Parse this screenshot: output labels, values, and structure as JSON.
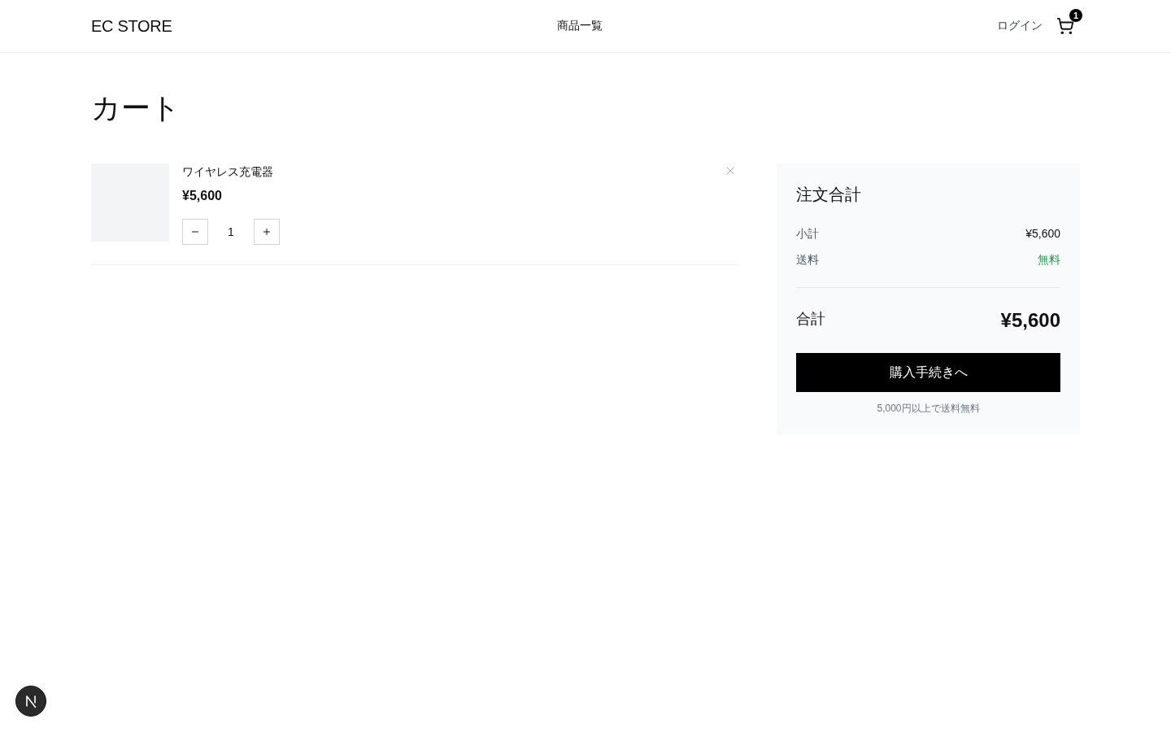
{
  "header": {
    "logo": "EC STORE",
    "nav": [
      {
        "label": "商品一覧"
      }
    ],
    "login": "ログイン",
    "cart_count": "1"
  },
  "page_title": "カート",
  "cart_items": [
    {
      "name": "ワイヤレス充電器",
      "price": "¥5,600",
      "quantity": "1"
    }
  ],
  "summary": {
    "title": "注文合計",
    "rows": [
      {
        "label": "小計",
        "value": "¥5,600",
        "kind": "amount"
      },
      {
        "label": "送料",
        "value": "無料",
        "kind": "free"
      }
    ],
    "total_label": "合計",
    "total_value": "¥5,600",
    "checkout_button": "購入手続きへ",
    "note": "5,000円以上で送料無料"
  }
}
